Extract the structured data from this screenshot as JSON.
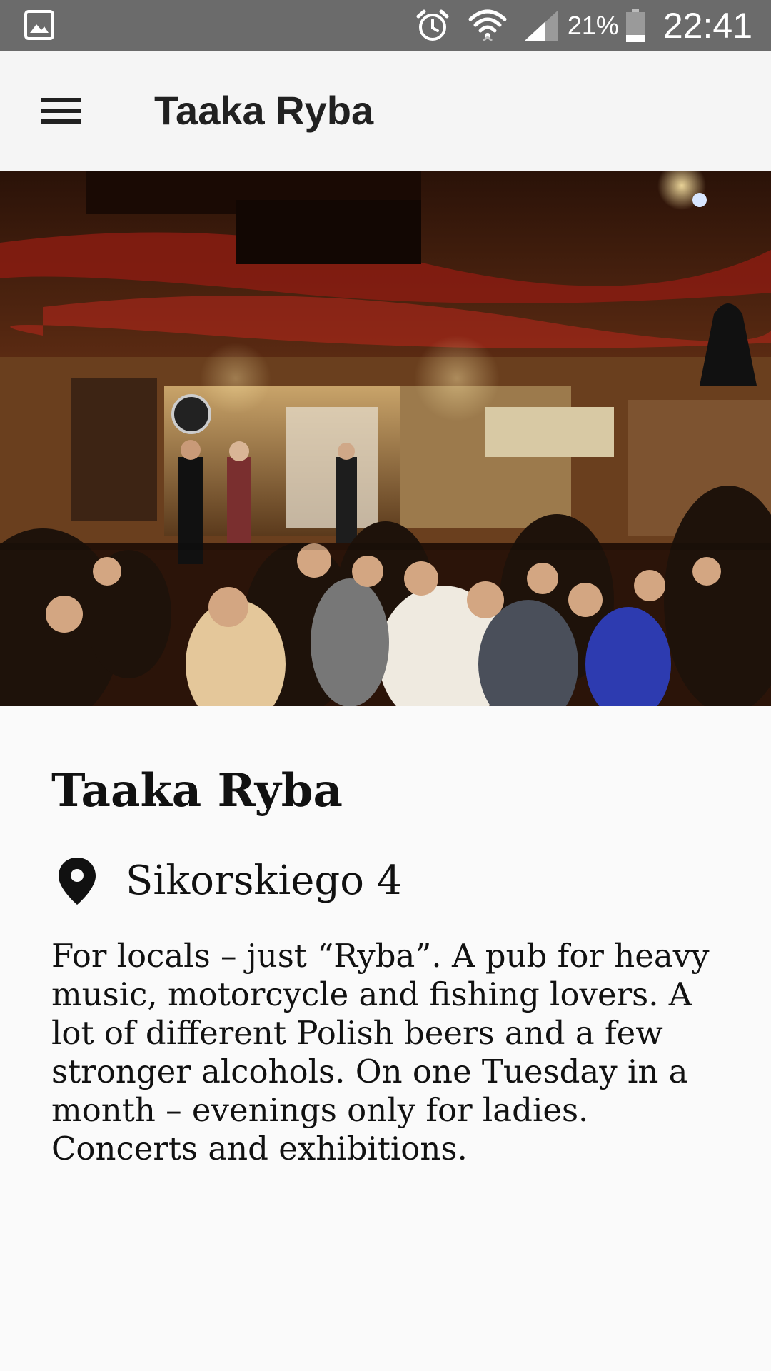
{
  "status_bar": {
    "battery_percent": "21%",
    "time": "22:41",
    "icons": [
      "gallery-icon",
      "alarm-icon",
      "wifi-icon",
      "signal-icon",
      "battery-icon"
    ]
  },
  "app_bar": {
    "title": "Taaka Ryba",
    "menu_icon": "hamburger-menu-icon"
  },
  "hero_image": {
    "subject": "photo"
  },
  "place": {
    "name": "Taaka Ryba",
    "address": "Sikorskiego 4",
    "address_icon": "location-pin-icon",
    "description": "For locals – just “Ryba”. A pub for heavy music, motorcycle and fishing lovers. A lot of different Polish beers and a few stronger alcohols. On one Tuesday in a month – evenings only for ladies. Concerts and exhibitions."
  },
  "colors": {
    "status_bar": "#6b6b6b",
    "app_bar": "#f5f5f5",
    "background": "#fafafa",
    "text": "#111111"
  }
}
